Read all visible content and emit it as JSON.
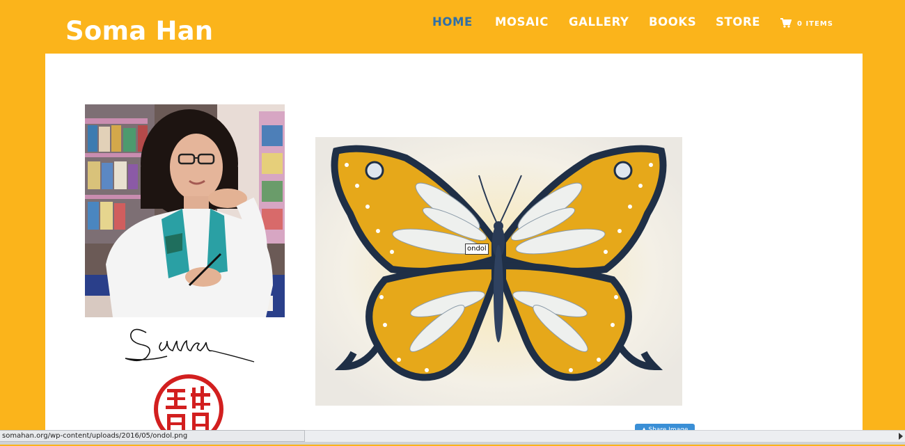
{
  "site": {
    "title": "Soma Han"
  },
  "nav": {
    "items": [
      {
        "label": "HOME",
        "active": true
      },
      {
        "label": "MOSAIC",
        "active": false
      },
      {
        "label": "GALLERY",
        "active": false
      },
      {
        "label": "BOOKS",
        "active": false
      },
      {
        "label": "STORE",
        "active": false
      }
    ],
    "cart_label": "0 ITEMS",
    "cart_icon": "shopping-cart-icon"
  },
  "colors": {
    "brand": "#fbb41b",
    "active_nav": "#2f6fa8",
    "content_bg": "#ffffff",
    "share_button": "#3a8fd6"
  },
  "main": {
    "artwork_tooltip": "ondol",
    "share_button_label": "Share Image",
    "share_icon": "pin-icon"
  },
  "statusbar": {
    "url": "somahan.org/wp-content/uploads/2016/05/ondol.png"
  }
}
